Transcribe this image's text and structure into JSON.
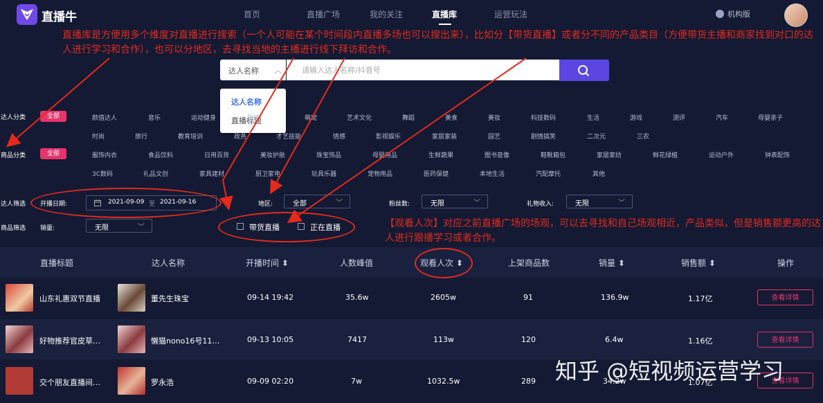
{
  "brand": {
    "name": "直播牛"
  },
  "nav": [
    "首页",
    "直播广场",
    "我的关注",
    "直播库",
    "运营玩法"
  ],
  "org_label": "机构版",
  "notes": {
    "top": "直播库是方便用多个维度对直播进行搜索（一个人可能在某个时间段内直播多场也可以搜出来），比如分【带货直播】或者分不同的产品类目（方便带货主播和商家找到对口的达人进行学习和合作），也可以分地区，去寻找当地的主播进行线下拜访和合作。",
    "right": "【观看人次】对应之前直播广场的场观，可以去寻找和自己场观相近，产品类似，但是销售额更高的达人进行跟播学习或者合作。"
  },
  "search": {
    "select_value": "达人名称",
    "placeholder": "请输入达人名称/抖音号",
    "options": [
      "达人名称",
      "直播标题"
    ]
  },
  "filters": {
    "talent_label": "达人分类",
    "product_label": "商品分类",
    "all_label": "全部",
    "talent_tags": [
      "颜值达人",
      "音乐",
      "运动健身",
      "剧情",
      "萌宠",
      "艺术文化",
      "舞蹈",
      "美食",
      "美妆",
      "科技数码",
      "生活",
      "游戏",
      "测评",
      "汽车",
      "母婴亲子",
      "时尚",
      "旅行",
      "教育培训",
      "政务",
      "才艺技能",
      "情感",
      "影视娱乐",
      "家居家装",
      "园艺",
      "剧情搞笑",
      "二次元",
      "三农"
    ],
    "product_tags": [
      "服饰内衣",
      "食品饮料",
      "日用百货",
      "美妆护肤",
      "珠宝饰品",
      "母婴用品",
      "生鲜蔬果",
      "图书音像",
      "鞋靴箱包",
      "家居家纺",
      "鲜花绿植",
      "运动户外",
      "钟表配饰",
      "3C数码",
      "礼品文创",
      "家具建材",
      "厨卫家电",
      "玩具乐器",
      "宠物用品",
      "医药保健",
      "本地生活",
      "汽配摩托",
      "其他"
    ]
  },
  "talent_filter": {
    "label": "达人筛选",
    "date_label": "开播日期:",
    "date_start": "2021-09-09",
    "date_sep": "至",
    "date_end": "2021-09-16",
    "region_label": "地区:",
    "region_value": "全部",
    "fans_label": "粉丝数:",
    "fans_value": "无限",
    "gift_label": "礼物收入:",
    "gift_value": "无限"
  },
  "product_filter": {
    "label": "商品筛选",
    "sales_label": "销量:",
    "sales_value": "无限",
    "check_goods": "带货直播",
    "check_live": "正在直播"
  },
  "table": {
    "headers": [
      "直播标题",
      "达人名称",
      "开播时间",
      "人数峰值",
      "观看人次",
      "上架商品数",
      "销量",
      "销售额",
      "操作"
    ],
    "sort_mark": "⬍",
    "rows": [
      {
        "title": "山东礼惠双节直播",
        "talent": "董先生珠宝",
        "time": "09-14 19:42",
        "peak": "35.6w",
        "views": "2605w",
        "items": "91",
        "sales": "136.9w",
        "revenue": "1.17亿",
        "action": "查看详情"
      },
      {
        "title": "好物推荐官皮草…",
        "talent": "懒猫nono16号11…",
        "time": "09-13 10:05",
        "peak": "7417",
        "views": "113w",
        "items": "120",
        "sales": "6.4w",
        "revenue": "1.16亿",
        "action": "查看详情"
      },
      {
        "title": "交个朋友直播间…",
        "talent": "罗永浩",
        "time": "09-09 02:20",
        "peak": "7w",
        "views": "1032.5w",
        "items": "289",
        "sales": "34.2w",
        "revenue": "1.07亿",
        "action": "查看详情"
      }
    ]
  },
  "watermark": "知乎 @短视频运营学习",
  "colors": {
    "bg": "#141a33",
    "accent": "#5b46e2",
    "pink": "#e8336d",
    "annotation": "#e32a1d"
  }
}
